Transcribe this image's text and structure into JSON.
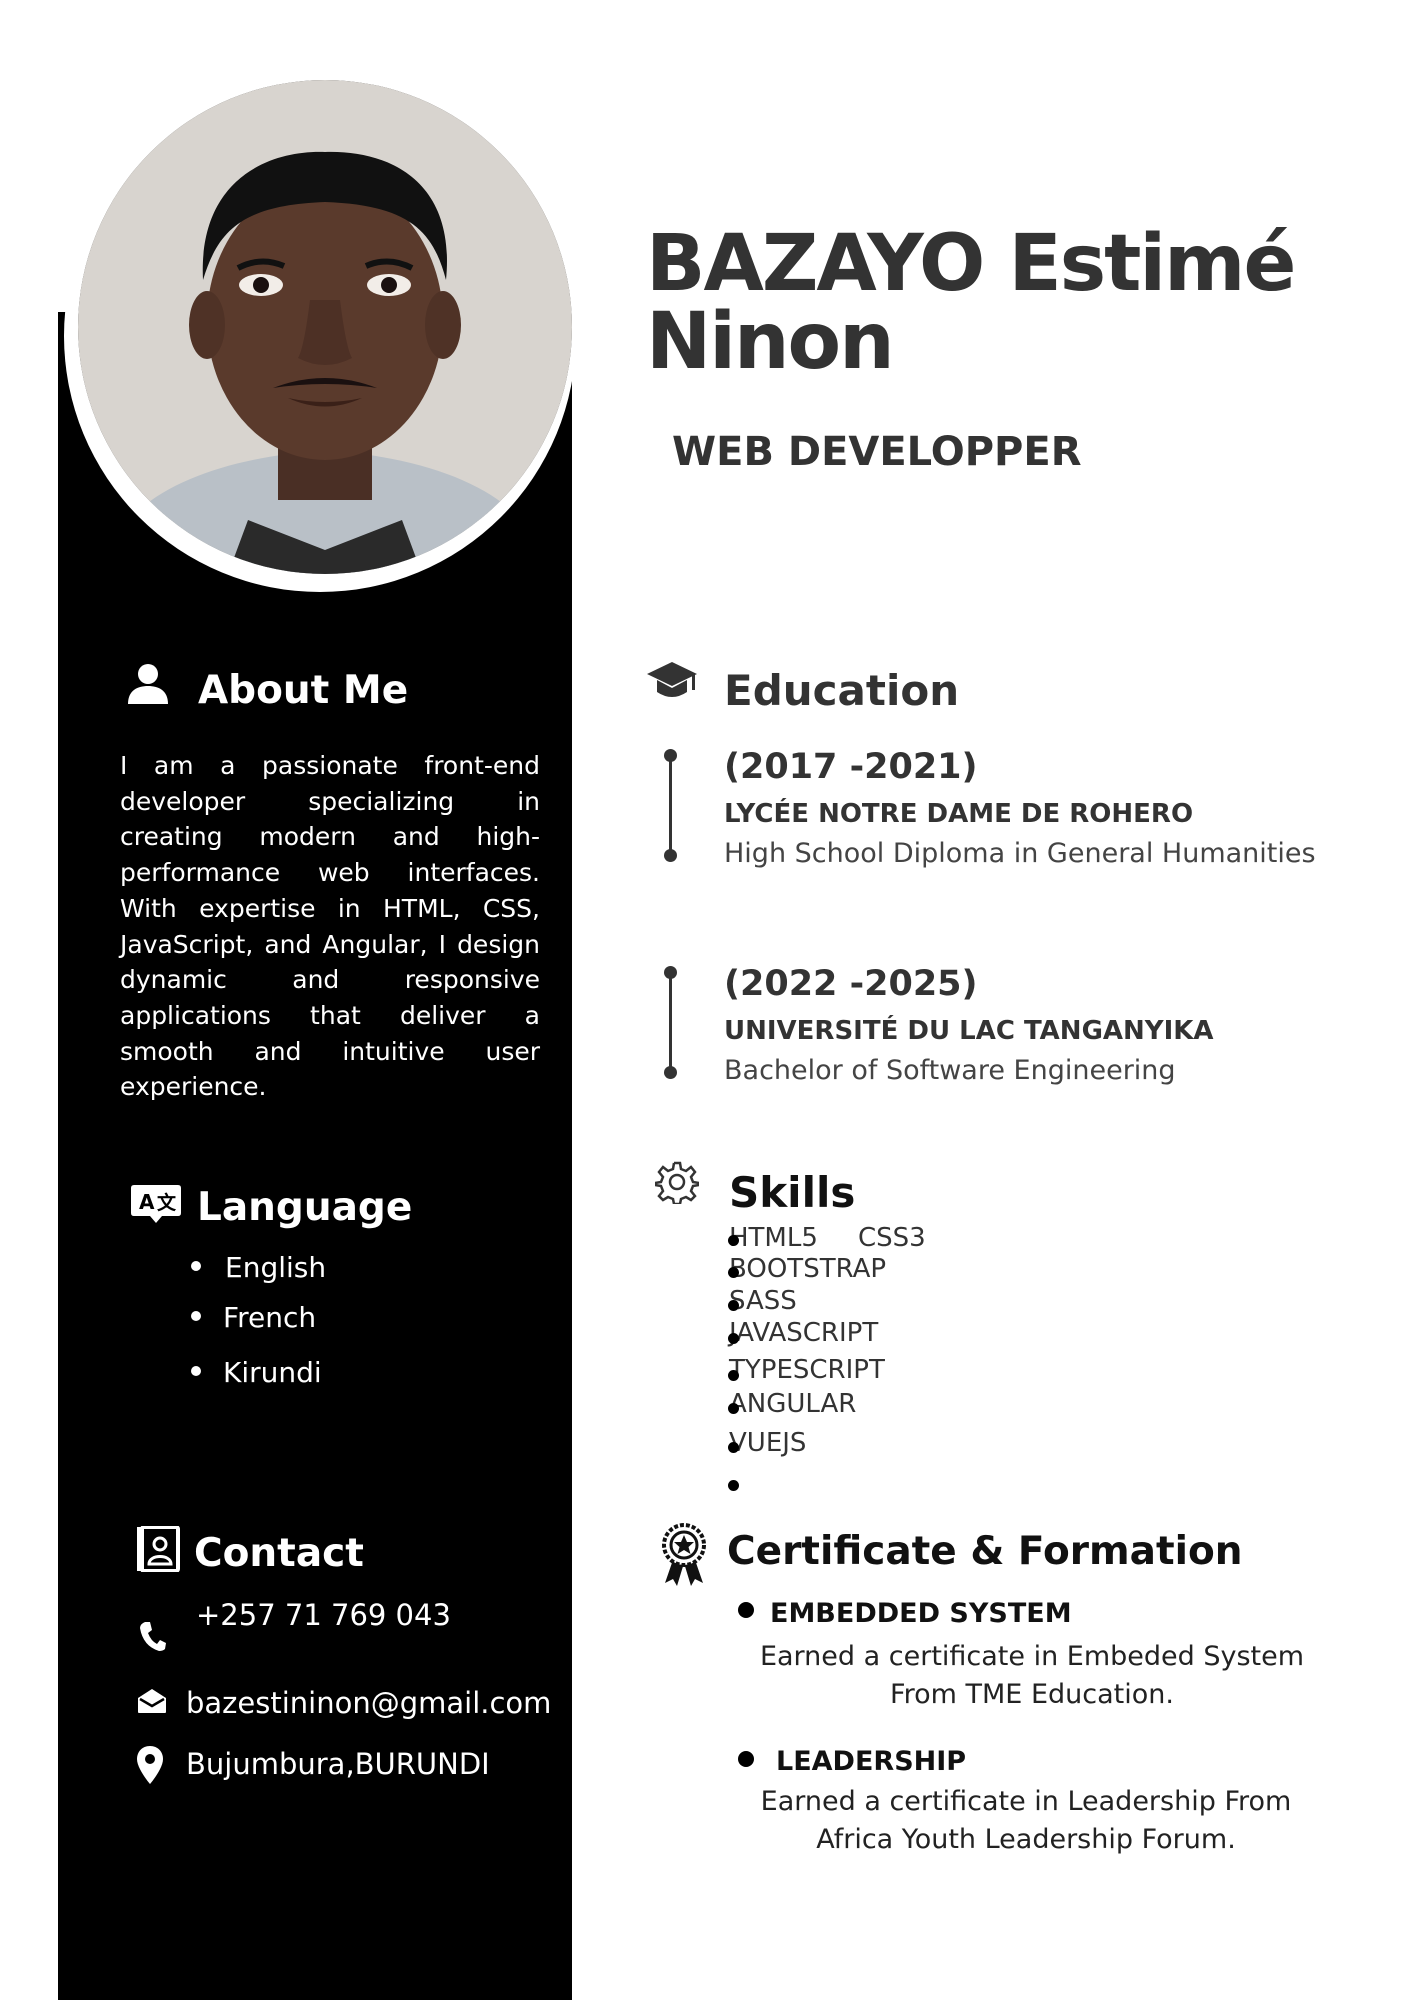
{
  "header": {
    "name": "BAZAYO Estimé Ninon",
    "job_title": "WEB DEVELOPPER"
  },
  "about": {
    "title": "About Me",
    "text": "I am a passionate front-end developer specializing in creating modern and high-performance web interfaces. With expertise in HTML, CSS, JavaScript, and Angular, I design dynamic and responsive applications that deliver a smooth and intuitive user experience."
  },
  "language": {
    "title": "Language",
    "items": [
      "English",
      "French",
      "Kirundi"
    ]
  },
  "contact": {
    "title": "Contact",
    "phone": "+257 71 769 043",
    "email": "bazestininon@gmail.com",
    "location": "Bujumbura,BURUNDI"
  },
  "education": {
    "title": "Education",
    "entries": [
      {
        "years": "(2017 -2021)",
        "school": "LYCÉE NOTRE DAME DE ROHERO",
        "degree": "High School Diploma in General Humanities"
      },
      {
        "years": "(2022 -2025)",
        "school": "UNIVERSITÉ DU LAC TANGANYIKA",
        "degree": "Bachelor of Software Engineering"
      }
    ]
  },
  "skills": {
    "title": "Skills",
    "items": [
      "HTML5",
      "CSS3",
      "BOOTSTRAP",
      "SASS",
      "JAVASCRIPT",
      "TYPESCRIPT",
      "ANGULAR",
      "VUEJS"
    ]
  },
  "certificates": {
    "title": "Certificate & Formation",
    "items": [
      {
        "name": "EMBEDDED SYSTEM",
        "description": "Earned a certificate in Embeded System From TME Education."
      },
      {
        "name": "LEADERSHIP",
        "description": "Earned a certificate in Leadership From Africa Youth Leadership Forum."
      }
    ]
  },
  "icons": {
    "about": "user-icon",
    "language": "translate-icon",
    "contact": "contact-book-icon",
    "phone": "phone-icon",
    "email": "envelope-icon",
    "location": "map-pin-icon",
    "education": "graduation-cap-icon",
    "skills": "gear-icon",
    "certificates": "award-ribbon-icon"
  },
  "colors": {
    "sidebar": "#000000",
    "text_dark": "#333333",
    "text_light": "#ffffff"
  }
}
